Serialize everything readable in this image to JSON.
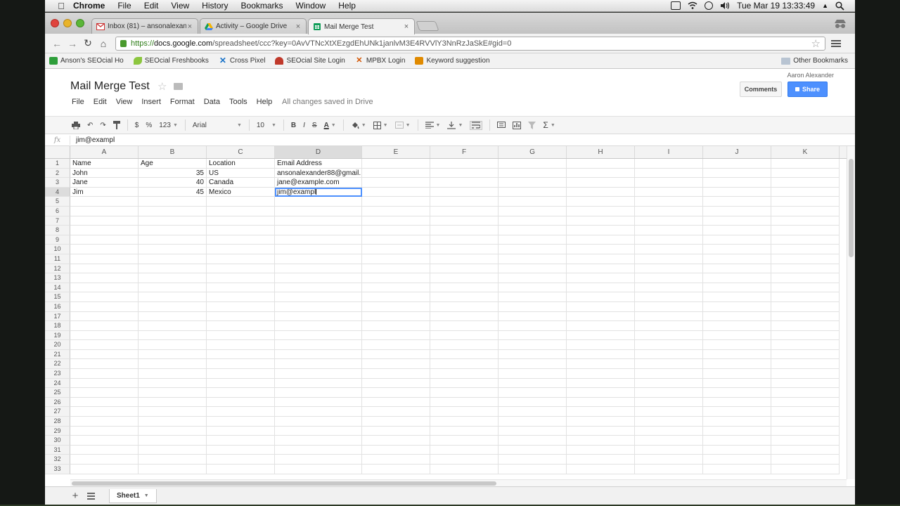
{
  "menubar": {
    "apple": "",
    "items": [
      "Chrome",
      "File",
      "Edit",
      "View",
      "History",
      "Bookmarks",
      "Window",
      "Help"
    ],
    "clock": "Tue Mar 19  13:33:49"
  },
  "tabs": [
    {
      "label": "Inbox (81) – ansonalexan",
      "favicon": "gmail-icon"
    },
    {
      "label": "Activity – Google Drive",
      "favicon": "drive-icon"
    },
    {
      "label": "Mail Merge Test",
      "favicon": "sheets-icon"
    }
  ],
  "omnibox": {
    "scheme": "https://",
    "host": "docs.google.com",
    "path": "/spreadsheet/ccc?key=0AvVTNcXtXEzgdEhUNk1janlvM3E4RVVlY3NnRzJaSkE#gid=0"
  },
  "bookmarks": [
    {
      "label": "Anson's SEOcial Ho",
      "color": "#2e9e3a"
    },
    {
      "label": "SEOcial Freshbooks",
      "color": "#8cc63f"
    },
    {
      "label": "Cross Pixel",
      "color": "#1a73c8"
    },
    {
      "label": "SEOcial Site Login",
      "color": "#c0392b"
    },
    {
      "label": "MPBX Login",
      "color": "#d35400"
    },
    {
      "label": "Keyword suggestion",
      "color": "#e08a00"
    }
  ],
  "other_bookmarks": "Other Bookmarks",
  "doc": {
    "user": "Aaron Alexander",
    "title": "Mail Merge Test",
    "comments": "Comments",
    "share": "Share",
    "menu": [
      "File",
      "Edit",
      "View",
      "Insert",
      "Format",
      "Data",
      "Tools",
      "Help"
    ],
    "saved": "All changes saved in Drive"
  },
  "toolbar": {
    "currency": "$",
    "percent": "%",
    "number_format": "123",
    "font": "Arial",
    "size": "10",
    "bold": "B",
    "italic": "I",
    "strike": "S",
    "color": "A",
    "sum": "Σ"
  },
  "formula": {
    "fx": "fx",
    "value": "jim@exampl"
  },
  "columns": [
    {
      "label": "A",
      "width": 97
    },
    {
      "label": "B",
      "width": 97
    },
    {
      "label": "C",
      "width": 97
    },
    {
      "label": "D",
      "width": 124
    },
    {
      "label": "E",
      "width": 97
    },
    {
      "label": "F",
      "width": 97
    },
    {
      "label": "G",
      "width": 97
    },
    {
      "label": "H",
      "width": 97
    },
    {
      "label": "I",
      "width": 97
    },
    {
      "label": "J",
      "width": 97
    },
    {
      "label": "K",
      "width": 97
    }
  ],
  "selected_column": 3,
  "selected_row": 4,
  "active_cell": {
    "row": 4,
    "col": 3
  },
  "cells": [
    [
      "Name",
      "Age",
      "Location",
      "Email Address"
    ],
    [
      "John",
      "35",
      "US",
      "ansonalexander88@gmail."
    ],
    [
      "Jane",
      "40",
      "Canada",
      "jane@example.com"
    ],
    [
      "Jim",
      "45",
      "Mexico",
      "jim@exampl"
    ]
  ],
  "numeric_columns": [
    1
  ],
  "row_count": 33,
  "sheet_tab": "Sheet1"
}
